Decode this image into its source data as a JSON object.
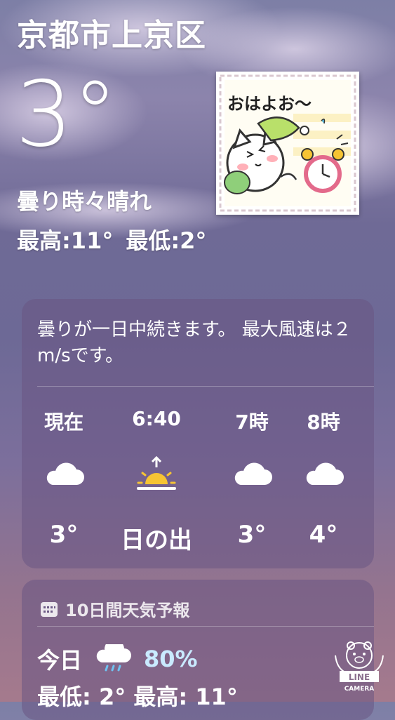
{
  "header": {
    "city": "京都市上京区",
    "temperature": "3°",
    "condition": "曇り時々晴れ",
    "high": "最高:11°",
    "low": "最低:2°"
  },
  "sticker": {
    "text": "おはよお〜"
  },
  "hourly": {
    "summary": "曇りが一日中続きます。 最大風速は２m/sです。",
    "items": [
      {
        "label": "現在",
        "icon": "cloud-icon",
        "value": "3°"
      },
      {
        "label": "6:40",
        "icon": "sunrise-icon",
        "value": "日の出"
      },
      {
        "label": "7時",
        "icon": "cloud-icon",
        "value": "3°"
      },
      {
        "label": "8時",
        "icon": "cloud-icon",
        "value": "4°"
      }
    ]
  },
  "ten_day": {
    "title": "10日間天気予報",
    "today": {
      "label": "今日",
      "icon": "rain-cloud-icon",
      "precip": "80%",
      "low_high": "最低: 2°  最高: 11°"
    }
  },
  "watermark": {
    "brand": "LINE",
    "sub": "CAMERA"
  },
  "colors": {
    "sunrise_yellow": "#f6c433",
    "precip_blue": "#c9eaff"
  }
}
